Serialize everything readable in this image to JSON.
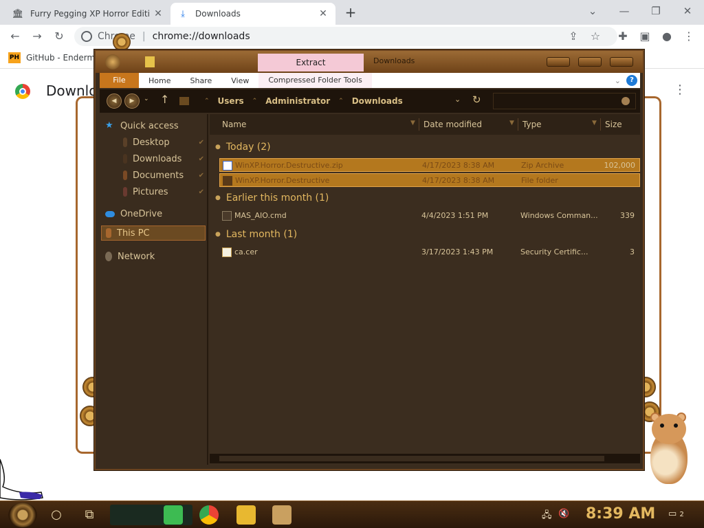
{
  "browser": {
    "tabs": [
      {
        "title": "Furry Pegging XP Horror Editi",
        "icon": "museum-icon",
        "active": false
      },
      {
        "title": "Downloads",
        "icon": "download-icon",
        "active": true
      }
    ],
    "new_tab": "+",
    "omnibox": {
      "scheme": "Chrome",
      "url": "chrome://downloads"
    },
    "bookmarks": [
      {
        "badge": "PH",
        "label": "GitHub - Enderma"
      }
    ],
    "page_title": "Downloads",
    "menu": "⋮"
  },
  "explorer": {
    "window_title": "Downloads",
    "context_tab": "Extract",
    "ribbon": {
      "file": "File",
      "tabs": [
        "Home",
        "Share",
        "View",
        "Compressed Folder Tools"
      ],
      "help": "?"
    },
    "breadcrumbs": [
      "Users",
      "Administrator",
      "Downloads"
    ],
    "nav_pane": {
      "quick_access": "Quick access",
      "quick_items": [
        "Desktop",
        "Downloads",
        "Documents",
        "Pictures"
      ],
      "onedrive": "OneDrive",
      "this_pc": "This PC",
      "network": "Network"
    },
    "columns": [
      "Name",
      "Date modified",
      "Type",
      "Size"
    ],
    "groups": [
      {
        "label": "Today (2)",
        "files": [
          {
            "name": "WinXP.Horror.Destructive.zip",
            "date": "4/17/2023 8:38 AM",
            "type": "Zip Archive",
            "size": "102,000",
            "selected": true
          },
          {
            "name": "WinXP.Horror.Destructive",
            "date": "4/17/2023 8:38 AM",
            "type": "File folder",
            "size": "",
            "selected": true
          }
        ]
      },
      {
        "label": "Earlier this month (1)",
        "files": [
          {
            "name": "MAS_AIO.cmd",
            "date": "4/4/2023 1:51 PM",
            "type": "Windows Comman...",
            "size": "339",
            "selected": false
          }
        ]
      },
      {
        "label": "Last month (1)",
        "files": [
          {
            "name": "ca.cer",
            "date": "3/17/2023 1:43 PM",
            "type": "Security Certific...",
            "size": "3",
            "selected": false
          }
        ]
      }
    ]
  },
  "taskbar": {
    "clock": "8:39 AM",
    "notification_count": "2"
  },
  "colors": {
    "accent": "#e3b860",
    "selection": "#b4781e",
    "window_bg": "#3b2d1f"
  }
}
